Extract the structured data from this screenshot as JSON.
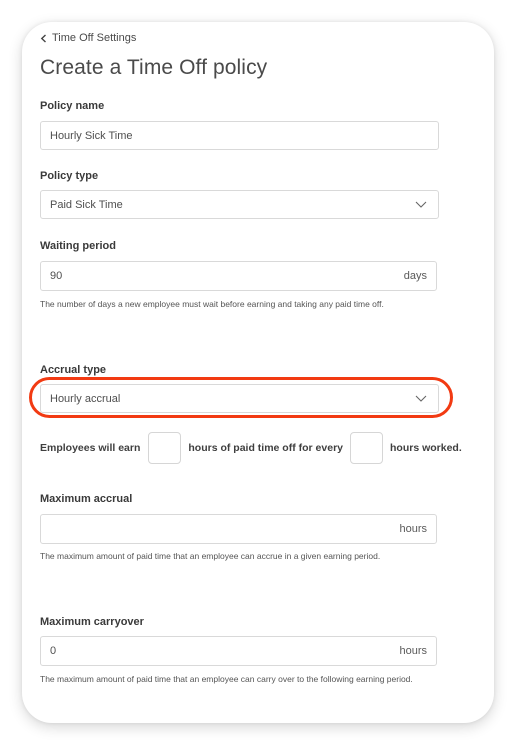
{
  "breadcrumb": {
    "back_label": "Time Off Settings",
    "icon": "chevron-left-icon"
  },
  "page_title": "Create a Time Off policy",
  "form": {
    "policy_name": {
      "label": "Policy name",
      "value": "Hourly Sick Time"
    },
    "policy_type": {
      "label": "Policy type",
      "selected": "Paid Sick Time",
      "icon": "chevron-down-icon"
    },
    "waiting_period": {
      "label": "Waiting period",
      "value": "90",
      "suffix": "days",
      "help": "The number of days a new employee must wait before earning and taking any paid time off."
    },
    "accrual_type": {
      "label": "Accrual type",
      "selected": "Hourly accrual",
      "icon": "chevron-down-icon",
      "highlighted": true,
      "highlight_color": "#f23a12"
    },
    "accrual_rate": {
      "text_before": "Employees will earn",
      "hours_earned_value": "",
      "text_middle": "hours of paid time off for every",
      "hours_worked_value": "",
      "text_after": "hours worked."
    },
    "maximum_accrual": {
      "label": "Maximum accrual",
      "value": "",
      "suffix": "hours",
      "help": "The maximum amount of paid time that an employee can accrue in a given earning period."
    },
    "maximum_carryover": {
      "label": "Maximum carryover",
      "value": "0",
      "suffix": "hours",
      "help": "The maximum amount of paid time that an employee can carry over to the following earning period."
    }
  }
}
